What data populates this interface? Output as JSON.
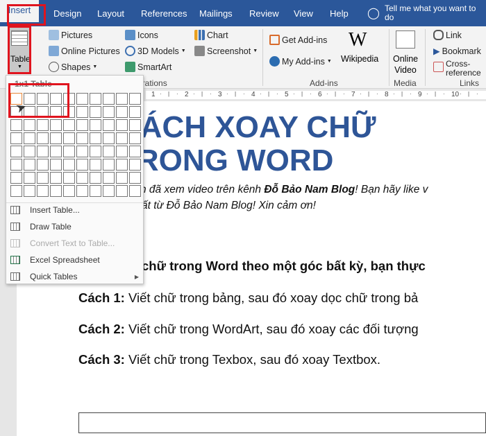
{
  "tabs": [
    "Insert",
    "Design",
    "Layout",
    "References",
    "Mailings",
    "Review",
    "View",
    "Help"
  ],
  "tell_me": "Tell me what you want to do",
  "ribbon": {
    "table": "Table",
    "pictures": "Pictures",
    "online_pictures": "Online Pictures",
    "shapes": "Shapes",
    "icons": "Icons",
    "models": "3D Models",
    "smartart": "SmartArt",
    "chart": "Chart",
    "screenshot": "Screenshot",
    "illustrations": "Illustrations",
    "get_addins": "Get Add-ins",
    "my_addins": "My Add-ins",
    "wikipedia": "Wikipedia",
    "wiki_logo": "W",
    "addins": "Add-ins",
    "online": "Online",
    "video": "Video",
    "media": "Media",
    "link": "Link",
    "bookmark": "Bookmark",
    "cross_ref": "Cross-reference",
    "links": "Links"
  },
  "ruler": [
    "1",
    "2",
    "3",
    "4",
    "5",
    "6",
    "7",
    "8",
    "9",
    "10"
  ],
  "dropdown": {
    "header": "1x1 Table",
    "grid": {
      "columns": 10,
      "rows": 8,
      "selected": [
        1,
        1
      ]
    },
    "items": [
      "Insert Table...",
      "Draw Table",
      "Convert Text to Table...",
      "Excel Spreadsheet",
      "Quick Tables"
    ]
  },
  "document": {
    "title": "CÁCH XOAY CHỮ TRONG WORD",
    "intro1_a": "n đã xem video trên kênh ",
    "intro1_b": "Đỗ Bảo Nam Blog",
    "intro1_c": "! Bạn hãy like v",
    "intro2": "ất từ Đỗ Bảo Nam Blog! Xin cảm ơn!",
    "heading": "chữ trong Word theo một góc bất kỳ, bạn thực",
    "methods": [
      {
        "label": "Cách 1:",
        "text": " Viết chữ trong bảng, sau đó xoay dọc chữ trong bả"
      },
      {
        "label": "Cách 2:",
        "text": " Viết chữ trong WordArt, sau đó xoay các đối tượng"
      },
      {
        "label": "Cách 3:",
        "text": " Viết chữ trong Texbox, sau đó xoay Textbox."
      }
    ]
  },
  "colors": {
    "accent": "#2b579a",
    "title": "#2e5597",
    "highlight": "#e0141e"
  }
}
